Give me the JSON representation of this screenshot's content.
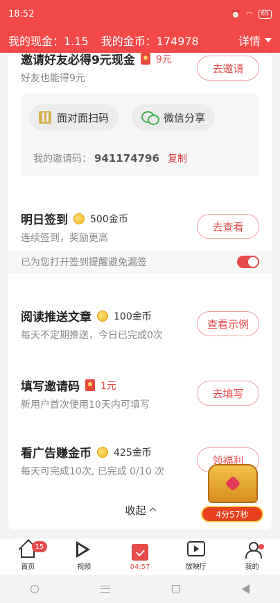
{
  "status_bar": {
    "time": "18:52",
    "battery": "65"
  },
  "header": {
    "cash_label": "我的现金：1.15",
    "coins_label": "我的金币：174978",
    "details_label": "详情"
  },
  "tasks": {
    "invite": {
      "title": "邀请好友必得9元现金",
      "reward": "9元",
      "subtitle": "好友也能得9元",
      "button": "去邀请",
      "face_to_face": "面对面扫码",
      "wechat_share": "微信分享",
      "code_label": "我的邀请码：",
      "code": "941174796",
      "copy": "复制"
    },
    "checkin": {
      "title": "明日签到",
      "reward": "500金币",
      "subtitle": "连续签到，奖励更高",
      "button": "去查看",
      "reminder": "已为您打开签到提醒避免漏签"
    },
    "read": {
      "title": "阅读推送文章",
      "reward": "100金币",
      "subtitle": "每天不定期推送，今日已完成0次",
      "button": "查看示例"
    },
    "fill_code": {
      "title": "填写邀请码",
      "reward": "1元",
      "subtitle": "新用户首次使用10天内可填写",
      "button": "去填写"
    },
    "ads": {
      "title": "看广告赚金币",
      "reward": "425金币",
      "subtitle": "每天可完成10次, 已完成 0/10 次",
      "button": "领福利"
    },
    "collapse_label": "收起"
  },
  "chest": {
    "timer": "4分57秒"
  },
  "bottom_nav": {
    "home": {
      "label": "首页",
      "badge": "15"
    },
    "video": {
      "label": "视频"
    },
    "checkin": {
      "label": "04:57"
    },
    "cinema": {
      "label": "放映厅"
    },
    "mine": {
      "label": "我的"
    }
  },
  "colors": {
    "accent": "#f24848",
    "brand_red": "#e74a4a",
    "coin": "#f0b31c"
  }
}
